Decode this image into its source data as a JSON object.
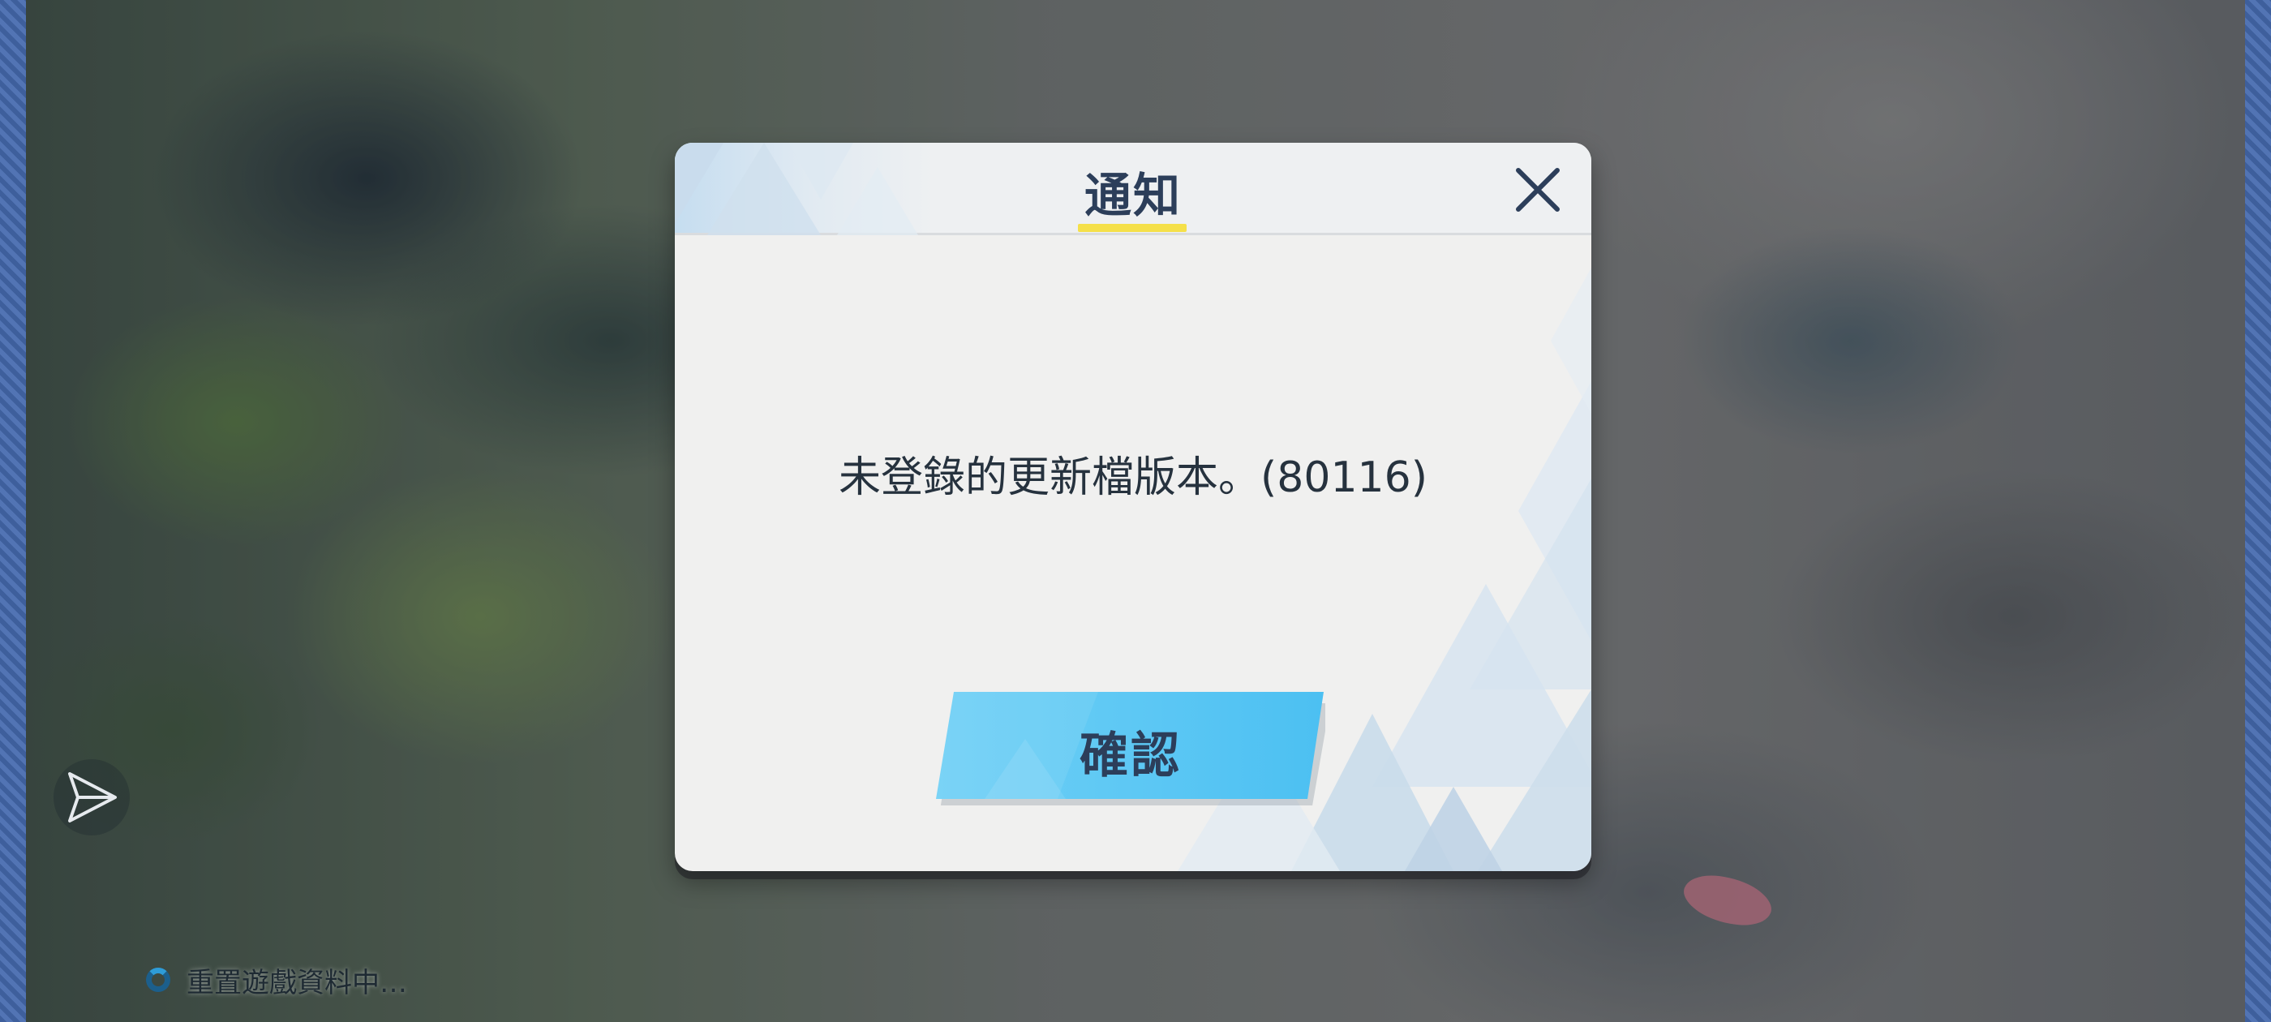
{
  "dialog": {
    "title": "通知",
    "message": "未登錄的更新檔版本。(80116)",
    "confirm_label": "確認",
    "close_icon": "close-icon"
  },
  "status": {
    "text": "重置遊戲資料中…"
  },
  "colors": {
    "title_text": "#2c3e5a",
    "title_underline": "#f5e04a",
    "confirm_button": "#5ac8f5",
    "side_bar": "#3e5f9c"
  },
  "icons": {
    "share": "share-icon",
    "spinner": "loading-spinner-icon"
  }
}
